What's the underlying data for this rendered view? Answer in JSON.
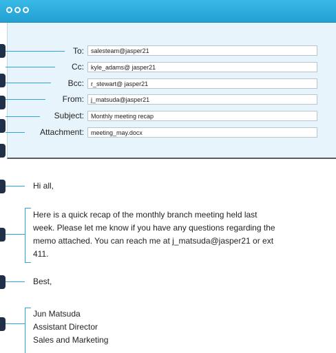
{
  "email": {
    "fields": [
      {
        "label": "To:",
        "value": "salesteam@jasper21"
      },
      {
        "label": "Cc:",
        "value": "kyle_adams@ jasper21"
      },
      {
        "label": "Bcc:",
        "value": "r_stewart@ jasper21"
      },
      {
        "label": "From:",
        "value": "j_matsuda@jasper21"
      },
      {
        "label": "Subject:",
        "value": "Monthly meeting recap"
      },
      {
        "label": "Attachment:",
        "value": "meeting_may.docx"
      }
    ],
    "greeting": "Hi all,",
    "body_lines": [
      "Here is a quick recap of the monthly branch meeting held last",
      "week. Please let me know if you have any questions regarding the",
      "memo attached. You can reach me at j_matsuda@jasper21 or ext",
      "411."
    ],
    "closing": "Best,",
    "signature": [
      "Jun Matsuda",
      "Assistant Director",
      "Sales and Marketing"
    ]
  },
  "colors": {
    "titlebar": "#27a6d8",
    "header_panel": "#e8f4fb",
    "accent_line": "#2aa4da",
    "tab": "#1f3048"
  }
}
